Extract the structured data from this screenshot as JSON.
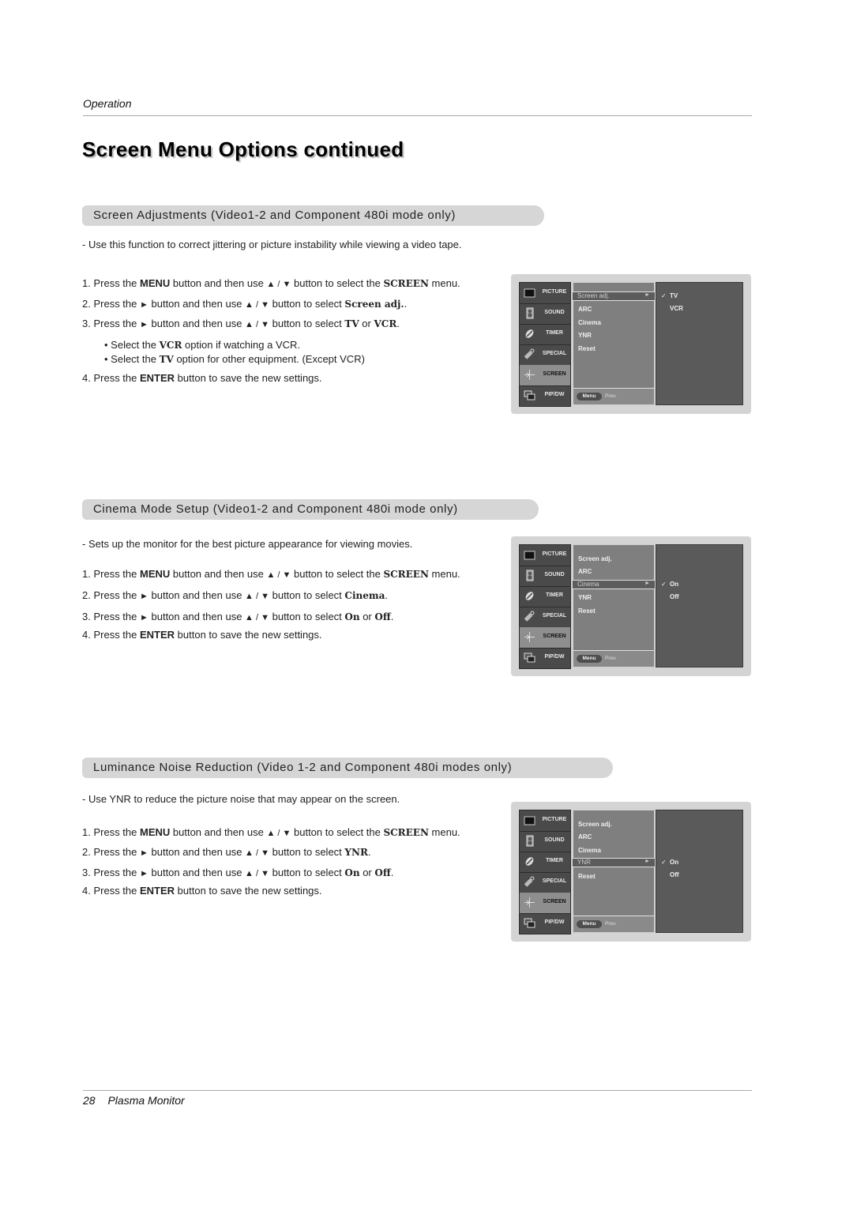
{
  "header": {
    "section_label": "Operation"
  },
  "page_title": "Screen Menu Options continued",
  "sections": [
    {
      "heading": "Screen Adjustments (Video1-2 and Component 480i mode only)",
      "description": "-  Use this function to correct jittering or picture instability while viewing a video tape.",
      "steps": [
        {
          "n": "1.",
          "pre": "Press the ",
          "b1": "MENU",
          "mid": " button and then use ",
          "sym": "▲ / ▼",
          "post": "  button to select the ",
          "b2": "SCREEN",
          "end": " menu."
        },
        {
          "n": "2.",
          "pre": "Press the ",
          "arrow": "►",
          "mid": " button and then use ",
          "sym": "▲ / ▼",
          "post": "  button to select ",
          "b2": "Screen adj.",
          "end": "."
        },
        {
          "n": "3.",
          "pre": "Press the ",
          "arrow": "►",
          "mid": " button and then use ",
          "sym": "▲ / ▼",
          "post": " button to select ",
          "b2": "TV",
          "or": " or ",
          "b3": "VCR",
          "end": "."
        },
        {
          "n": "4.",
          "pre": "Press the ",
          "b1": "ENTER",
          "end": " button to save the new settings."
        }
      ],
      "bullets": [
        {
          "pre": "• Select the ",
          "b": "VCR",
          "post": " option if watching a VCR."
        },
        {
          "pre": "• Select the ",
          "b": "TV",
          "post": " option for other equipment. (Except VCR)"
        }
      ],
      "osd": {
        "highlight": "Screen adj.",
        "highlight_index": 0,
        "options": [
          "Screen adj.",
          "ARC",
          "Cinema",
          "YNR",
          "Reset"
        ],
        "right_options": [
          "TV",
          "VCR"
        ],
        "checked": "TV"
      }
    },
    {
      "heading": "Cinema Mode Setup (Video1-2 and Component 480i mode only)",
      "description": "-  Sets up the monitor for the best picture appearance for viewing movies.",
      "steps": [
        {
          "n": "1.",
          "pre": "Press the ",
          "b1": "MENU",
          "mid": " button and then use ",
          "sym": "▲ / ▼",
          "post": "  button to select the ",
          "b2": "SCREEN",
          "end": " menu."
        },
        {
          "n": "2.",
          "pre": "Press the ",
          "arrow": "►",
          "mid": "  button and then use ",
          "sym": "▲ / ▼",
          "post": " button to select ",
          "b2": "Cinema",
          "end": "."
        },
        {
          "n": "3.",
          "pre": "Press the ",
          "arrow": "►",
          "mid": "  button and then use ",
          "sym": "▲ / ▼",
          "post": " button to select ",
          "b2": "On",
          "or": " or ",
          "b3": "Off",
          "end": "."
        },
        {
          "n": "4.",
          "pre": "Press the ",
          "b1": "ENTER",
          "end": " button to save the new settings."
        }
      ],
      "osd": {
        "highlight": "Cinema",
        "highlight_index": 2,
        "options": [
          "Screen adj.",
          "ARC",
          "Cinema",
          "YNR",
          "Reset"
        ],
        "right_options": [
          "On",
          "Off"
        ],
        "checked": "On"
      }
    },
    {
      "heading": "Luminance Noise Reduction (Video 1-2 and Component 480i modes only)",
      "description": "-  Use YNR to reduce the picture noise that may appear on the screen.",
      "steps": [
        {
          "n": "1.",
          "pre": "Press the ",
          "b1": "MENU",
          "mid": " button and then use ",
          "sym": "▲ / ▼",
          "post": "  button to select the ",
          "b2": "SCREEN",
          "end": " menu."
        },
        {
          "n": "2.",
          "pre": "Press the ",
          "arrow": "►",
          "mid": " button and then use ",
          "sym": "▲ / ▼",
          "post": "  button to select ",
          "b2": "YNR",
          "end": "."
        },
        {
          "n": "3.",
          "pre": "Press the ",
          "arrow": "►",
          "mid": " button and then use ",
          "sym": "▲ / ▼",
          "post": "  button to select ",
          "b2": "On",
          "or": " or ",
          "b3": "Off",
          "end": "."
        },
        {
          "n": "4.",
          "pre": "Press the ",
          "b1": "ENTER",
          "end": " button to save the new settings."
        }
      ],
      "osd": {
        "highlight": "YNR",
        "highlight_index": 3,
        "options": [
          "Screen adj.",
          "ARC",
          "Cinema",
          "YNR",
          "Reset"
        ],
        "right_options": [
          "On",
          "Off"
        ],
        "checked": "On"
      }
    }
  ],
  "osd_common": {
    "sidebar": [
      "PICTURE",
      "SOUND",
      "TIMER",
      "SPECIAL",
      "SCREEN",
      "PIP/DW"
    ],
    "sidebar_selected": "SCREEN",
    "menu_button": "Menu",
    "prev_label": "Prev.",
    "arrow_glyph": "►",
    "check_glyph": "✓"
  },
  "footer": {
    "page_number": "28",
    "product": "Plasma Monitor"
  }
}
